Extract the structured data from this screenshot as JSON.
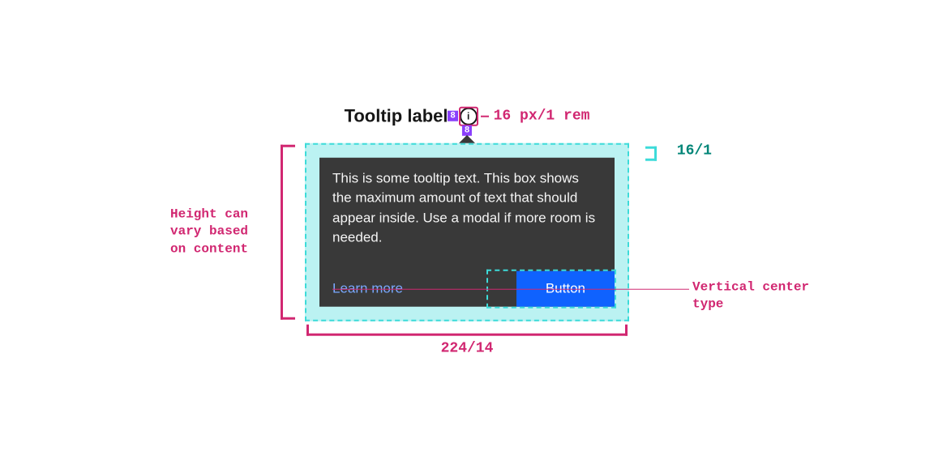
{
  "tooltip": {
    "label": "Tooltip label",
    "body": "This is some tooltip text. This box shows the maximum amount of text that should appear inside. Use a modal if more room is needed.",
    "link": "Learn more",
    "button": "Button"
  },
  "spacers": {
    "gap_horizontal": "8",
    "gap_vertical": "8"
  },
  "annotations": {
    "icon_size": "16 px/1 rem",
    "padding_top": "16/1",
    "width": "224/14",
    "height_note": "Height can vary based on content",
    "centerline_note": "Vertical center type"
  },
  "colors": {
    "pink": "#d12771",
    "teal": "#3ddbd9",
    "panel_bg": "#393939",
    "link": "#78a9ff",
    "button_bg": "#0f62fe",
    "purple": "#8a3ffc"
  }
}
